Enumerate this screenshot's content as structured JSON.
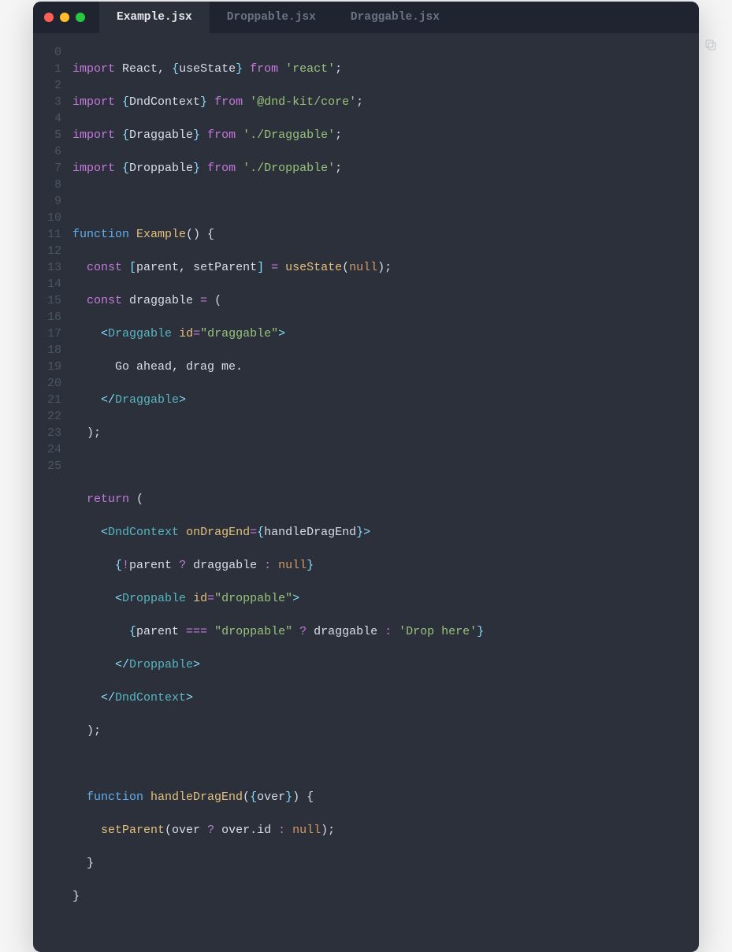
{
  "tabs": [
    {
      "label": "Example.jsx",
      "active": true
    },
    {
      "label": "Droppable.jsx",
      "active": false
    },
    {
      "label": "Draggable.jsx",
      "active": false
    }
  ],
  "gutter": [
    "0",
    "1",
    "2",
    "3",
    "4",
    "5",
    "6",
    "7",
    "8",
    "9",
    "10",
    "11",
    "12",
    "13",
    "14",
    "15",
    "16",
    "17",
    "18",
    "19",
    "20",
    "21",
    "22",
    "23",
    "24",
    "25"
  ],
  "code": {
    "l0": {
      "import": "import",
      "react": "React",
      "comma": ", ",
      "ob": "{",
      "us": "useState",
      "cb": "}",
      "from": " from ",
      "str": "'react'",
      "semi": ";"
    },
    "l1": {
      "import": "import",
      "ob": " {",
      "dc": "DndContext",
      "cb": "}",
      "from": " from ",
      "str": "'@dnd-kit/core'",
      "semi": ";"
    },
    "l2": {
      "import": "import",
      "ob": " {",
      "dr": "Draggable",
      "cb": "}",
      "from": " from ",
      "str": "'./Draggable'",
      "semi": ";"
    },
    "l3": {
      "import": "import",
      "ob": " {",
      "dp": "Droppable",
      "cb": "}",
      "from": " from ",
      "str": "'./Droppable'",
      "semi": ";"
    },
    "l5": {
      "fn": "function",
      "name": " Example",
      "rest": "() {"
    },
    "l6": {
      "const": "  const",
      "br": " [",
      "p": "parent",
      "c": ", ",
      "sp": "setParent",
      "br2": "] ",
      "eq": "=",
      "us": " useState",
      "op": "(",
      "null": "null",
      "cp": ");"
    },
    "l7": {
      "const": "  const",
      "dr": " draggable ",
      "eq": "=",
      "op": " ("
    },
    "l8": {
      "ind": "    ",
      "lt": "<",
      "tag": "Draggable",
      "sp": " ",
      "attr": "id",
      "eq": "=",
      "str": "\"draggable\"",
      "gt": ">"
    },
    "l9": {
      "txt": "      Go ahead, drag me."
    },
    "l10": {
      "ind": "    ",
      "lt": "</",
      "tag": "Draggable",
      "gt": ">"
    },
    "l11": {
      "txt": "  );"
    },
    "l13": {
      "ret": "  return",
      "op": " ("
    },
    "l14": {
      "ind": "    ",
      "lt": "<",
      "tag": "DndContext",
      "sp": " ",
      "attr": "onDragEnd",
      "eq": "=",
      "ob": "{",
      "fn": "handleDragEnd",
      "cb": "}",
      "gt": ">"
    },
    "l15": {
      "ind": "      ",
      "ob": "{",
      "not": "!",
      "p": "parent ",
      "q": "?",
      "d": " draggable ",
      "col": ":",
      "null": " null",
      "cb": "}"
    },
    "l16": {
      "ind": "      ",
      "lt": "<",
      "tag": "Droppable",
      "sp": " ",
      "attr": "id",
      "eq": "=",
      "str": "\"droppable\"",
      "gt": ">"
    },
    "l17": {
      "ind": "        ",
      "ob": "{",
      "p": "parent ",
      "eqq": "===",
      "str": " \"droppable\" ",
      "q": "?",
      "d": " draggable ",
      "col": ":",
      "str2": " 'Drop here'",
      "cb": "}"
    },
    "l18": {
      "ind": "      ",
      "lt": "</",
      "tag": "Droppable",
      "gt": ">"
    },
    "l19": {
      "ind": "    ",
      "lt": "</",
      "tag": "DndContext",
      "gt": ">"
    },
    "l20": {
      "txt": "  );"
    },
    "l22": {
      "fn": "  function",
      "name": " handleDragEnd",
      "op": "(",
      "ob": "{",
      "ov": "over",
      "cb": "}",
      "cp": ") {"
    },
    "l23": {
      "ind": "    ",
      "sp": "setParent",
      "op": "(",
      "ov": "over ",
      "q": "?",
      "ovid": " over.id ",
      "col": ":",
      "null": " null",
      "cp": ");"
    },
    "l24": {
      "txt": "  }"
    },
    "l25": {
      "txt": "}"
    }
  }
}
